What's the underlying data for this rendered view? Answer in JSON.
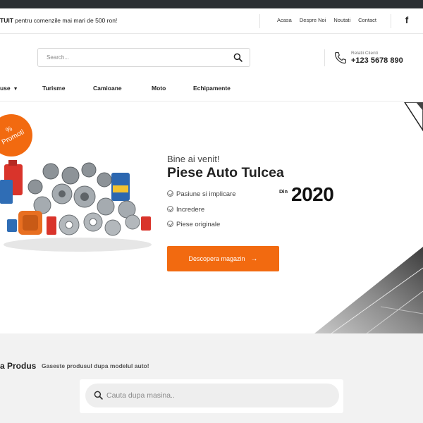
{
  "infobar": {
    "promo_bold": "TUIT",
    "promo_rest": " pentru comenzile mai mari de 500 ron!",
    "links": [
      "Acasa",
      "Despre Noi",
      "Noutati",
      "Contact"
    ],
    "social_icon": "facebook-icon"
  },
  "header": {
    "search_placeholder": "Search...",
    "search_icon": "search-icon",
    "phone_label": "Relatii Clienti",
    "phone_number": "+123 5678 890",
    "phone_icon": "phone-icon"
  },
  "nav": {
    "items": [
      "use",
      "Turisme",
      "Camioane",
      "Moto",
      "Echipamente"
    ]
  },
  "hero": {
    "badge_text": "%\nPromoti",
    "subtitle": "Bine ai venit!",
    "title": "Piese Auto Tulcea",
    "features": [
      "Pasiune si implicare",
      "Incredere",
      "Piese originale"
    ],
    "since_label": "Din",
    "since_year": "2020",
    "cta_label": "Descopera magazin",
    "cta_arrow": "→"
  },
  "product_search": {
    "title": "a Produs",
    "subtitle": "Gaseste produsul dupa modelul auto!",
    "placeholder": "Cauta dupa masina.."
  },
  "colors": {
    "accent": "#f26a10",
    "topbar": "#2b2f33",
    "section_bg": "#f2f2f2"
  }
}
